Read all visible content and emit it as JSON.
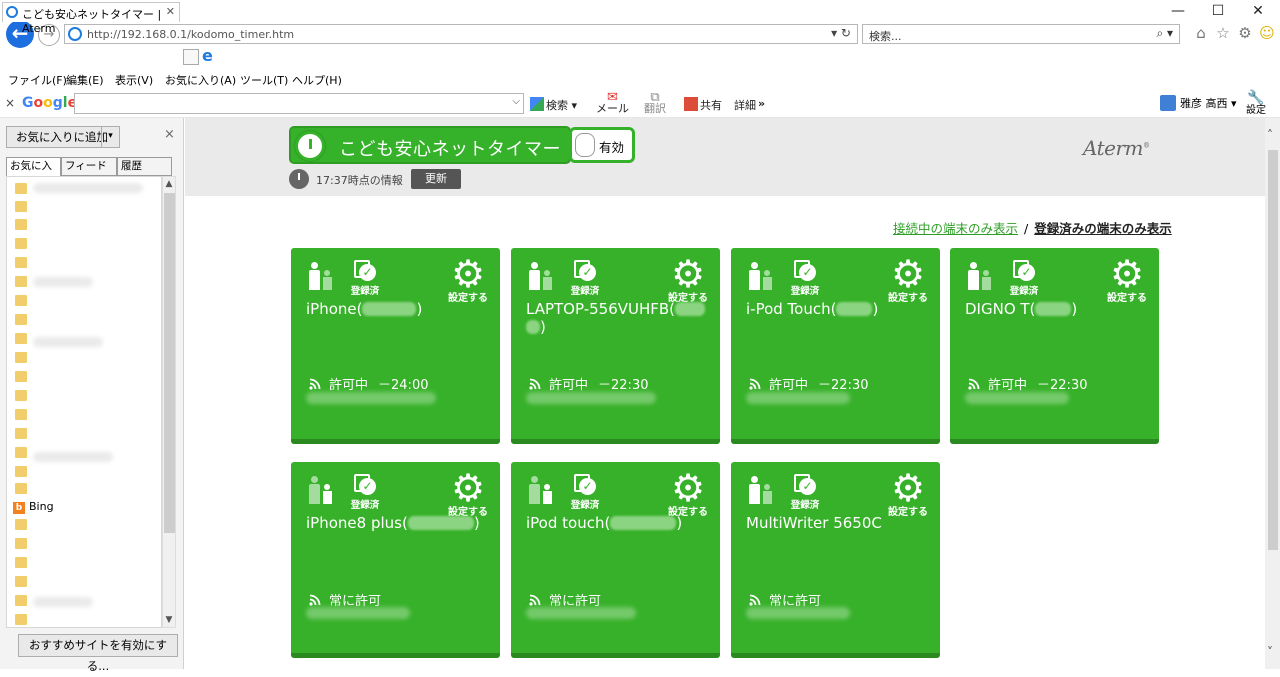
{
  "window": {
    "minimize": "—",
    "maximize": "☐",
    "close": "✕"
  },
  "address": {
    "url": "http://192.168.0.1/kodomo_timer.htm",
    "tail": "▾ ↻"
  },
  "search": {
    "placeholder": "検索...",
    "icon": "⌕ ▾"
  },
  "toolbar_icons": {
    "home": "⌂",
    "star": "☆",
    "gear": "⚙",
    "smiley": "☺"
  },
  "tab": {
    "title": "こども安心ネットタイマー | Aterm",
    "close": "✕"
  },
  "menu": [
    "ファイル(F)",
    "編集(E)",
    "表示(V)",
    "お気に入り(A)",
    "ツール(T)",
    "ヘルプ(H)"
  ],
  "google_bar": {
    "close": "×",
    "logo": "Google",
    "dropdown": "⌵",
    "search_btn": "検索",
    "mail": "メール",
    "translate": "翻訳",
    "share": "共有",
    "details": "詳細",
    "more": "»",
    "user": "雅彦 高西",
    "settings": "設定"
  },
  "favorites": {
    "add_button": "お気に入りに追加",
    "add_arrow": "▾",
    "close": "×",
    "tabs": [
      "お気に入り",
      "フィード",
      "履歴"
    ],
    "bing": "Bing",
    "suggest_button": "おすすめサイトを有効にする..."
  },
  "page": {
    "logo_text": "こども安心ネットタイマー",
    "toggle_label": "有効",
    "brand": "Aterm",
    "info_time": "17:37時点の情報",
    "refresh": "更新",
    "filter_connected": "接続中の端末のみ表示",
    "filter_sep": "/",
    "filter_registered": "登録済みの端末のみ表示"
  },
  "card_labels": {
    "registered": "登録済",
    "settings": "設定する"
  },
  "devices": [
    {
      "name": "iPhone(",
      "name_end": ")",
      "status": "許可中",
      "time": "－24:00"
    },
    {
      "name": "LAPTOP-556VUHFB(",
      "name_end": ")",
      "status": "許可中",
      "time": "－22:30"
    },
    {
      "name": "i-Pod Touch(",
      "name_end": ")",
      "status": "許可中",
      "time": "－22:30"
    },
    {
      "name": "DIGNO T(",
      "name_end": ")",
      "status": "許可中",
      "time": "－22:30"
    },
    {
      "name": "iPhone8 plus(",
      "name_end": ")",
      "status": "常に許可",
      "time": ""
    },
    {
      "name": "iPod touch(",
      "name_end": ")",
      "status": "常に許可",
      "time": ""
    },
    {
      "name": "MultiWriter 5650C",
      "name_end": "",
      "status": "常に許可",
      "time": ""
    }
  ],
  "colors": {
    "card_green": "#37b12a",
    "link_green": "#2e9f26",
    "nav_blue": "#1d6fe0"
  }
}
